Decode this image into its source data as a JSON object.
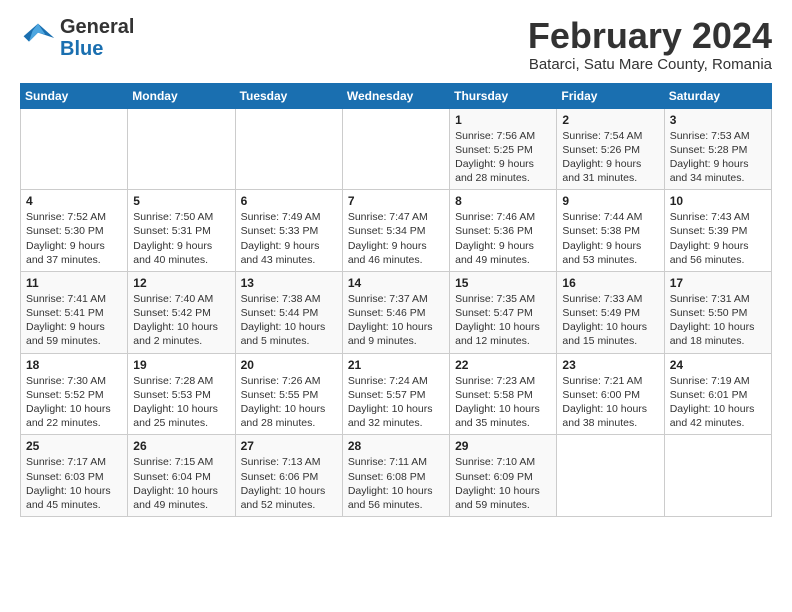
{
  "logo": {
    "line1": "General",
    "line2": "Blue"
  },
  "title": "February 2024",
  "subtitle": "Batarci, Satu Mare County, Romania",
  "days_of_week": [
    "Sunday",
    "Monday",
    "Tuesday",
    "Wednesday",
    "Thursday",
    "Friday",
    "Saturday"
  ],
  "weeks": [
    [
      {
        "day": "",
        "info": ""
      },
      {
        "day": "",
        "info": ""
      },
      {
        "day": "",
        "info": ""
      },
      {
        "day": "",
        "info": ""
      },
      {
        "day": "1",
        "info": "Sunrise: 7:56 AM\nSunset: 5:25 PM\nDaylight: 9 hours and 28 minutes."
      },
      {
        "day": "2",
        "info": "Sunrise: 7:54 AM\nSunset: 5:26 PM\nDaylight: 9 hours and 31 minutes."
      },
      {
        "day": "3",
        "info": "Sunrise: 7:53 AM\nSunset: 5:28 PM\nDaylight: 9 hours and 34 minutes."
      }
    ],
    [
      {
        "day": "4",
        "info": "Sunrise: 7:52 AM\nSunset: 5:30 PM\nDaylight: 9 hours and 37 minutes."
      },
      {
        "day": "5",
        "info": "Sunrise: 7:50 AM\nSunset: 5:31 PM\nDaylight: 9 hours and 40 minutes."
      },
      {
        "day": "6",
        "info": "Sunrise: 7:49 AM\nSunset: 5:33 PM\nDaylight: 9 hours and 43 minutes."
      },
      {
        "day": "7",
        "info": "Sunrise: 7:47 AM\nSunset: 5:34 PM\nDaylight: 9 hours and 46 minutes."
      },
      {
        "day": "8",
        "info": "Sunrise: 7:46 AM\nSunset: 5:36 PM\nDaylight: 9 hours and 49 minutes."
      },
      {
        "day": "9",
        "info": "Sunrise: 7:44 AM\nSunset: 5:38 PM\nDaylight: 9 hours and 53 minutes."
      },
      {
        "day": "10",
        "info": "Sunrise: 7:43 AM\nSunset: 5:39 PM\nDaylight: 9 hours and 56 minutes."
      }
    ],
    [
      {
        "day": "11",
        "info": "Sunrise: 7:41 AM\nSunset: 5:41 PM\nDaylight: 9 hours and 59 minutes."
      },
      {
        "day": "12",
        "info": "Sunrise: 7:40 AM\nSunset: 5:42 PM\nDaylight: 10 hours and 2 minutes."
      },
      {
        "day": "13",
        "info": "Sunrise: 7:38 AM\nSunset: 5:44 PM\nDaylight: 10 hours and 5 minutes."
      },
      {
        "day": "14",
        "info": "Sunrise: 7:37 AM\nSunset: 5:46 PM\nDaylight: 10 hours and 9 minutes."
      },
      {
        "day": "15",
        "info": "Sunrise: 7:35 AM\nSunset: 5:47 PM\nDaylight: 10 hours and 12 minutes."
      },
      {
        "day": "16",
        "info": "Sunrise: 7:33 AM\nSunset: 5:49 PM\nDaylight: 10 hours and 15 minutes."
      },
      {
        "day": "17",
        "info": "Sunrise: 7:31 AM\nSunset: 5:50 PM\nDaylight: 10 hours and 18 minutes."
      }
    ],
    [
      {
        "day": "18",
        "info": "Sunrise: 7:30 AM\nSunset: 5:52 PM\nDaylight: 10 hours and 22 minutes."
      },
      {
        "day": "19",
        "info": "Sunrise: 7:28 AM\nSunset: 5:53 PM\nDaylight: 10 hours and 25 minutes."
      },
      {
        "day": "20",
        "info": "Sunrise: 7:26 AM\nSunset: 5:55 PM\nDaylight: 10 hours and 28 minutes."
      },
      {
        "day": "21",
        "info": "Sunrise: 7:24 AM\nSunset: 5:57 PM\nDaylight: 10 hours and 32 minutes."
      },
      {
        "day": "22",
        "info": "Sunrise: 7:23 AM\nSunset: 5:58 PM\nDaylight: 10 hours and 35 minutes."
      },
      {
        "day": "23",
        "info": "Sunrise: 7:21 AM\nSunset: 6:00 PM\nDaylight: 10 hours and 38 minutes."
      },
      {
        "day": "24",
        "info": "Sunrise: 7:19 AM\nSunset: 6:01 PM\nDaylight: 10 hours and 42 minutes."
      }
    ],
    [
      {
        "day": "25",
        "info": "Sunrise: 7:17 AM\nSunset: 6:03 PM\nDaylight: 10 hours and 45 minutes."
      },
      {
        "day": "26",
        "info": "Sunrise: 7:15 AM\nSunset: 6:04 PM\nDaylight: 10 hours and 49 minutes."
      },
      {
        "day": "27",
        "info": "Sunrise: 7:13 AM\nSunset: 6:06 PM\nDaylight: 10 hours and 52 minutes."
      },
      {
        "day": "28",
        "info": "Sunrise: 7:11 AM\nSunset: 6:08 PM\nDaylight: 10 hours and 56 minutes."
      },
      {
        "day": "29",
        "info": "Sunrise: 7:10 AM\nSunset: 6:09 PM\nDaylight: 10 hours and 59 minutes."
      },
      {
        "day": "",
        "info": ""
      },
      {
        "day": "",
        "info": ""
      }
    ]
  ]
}
